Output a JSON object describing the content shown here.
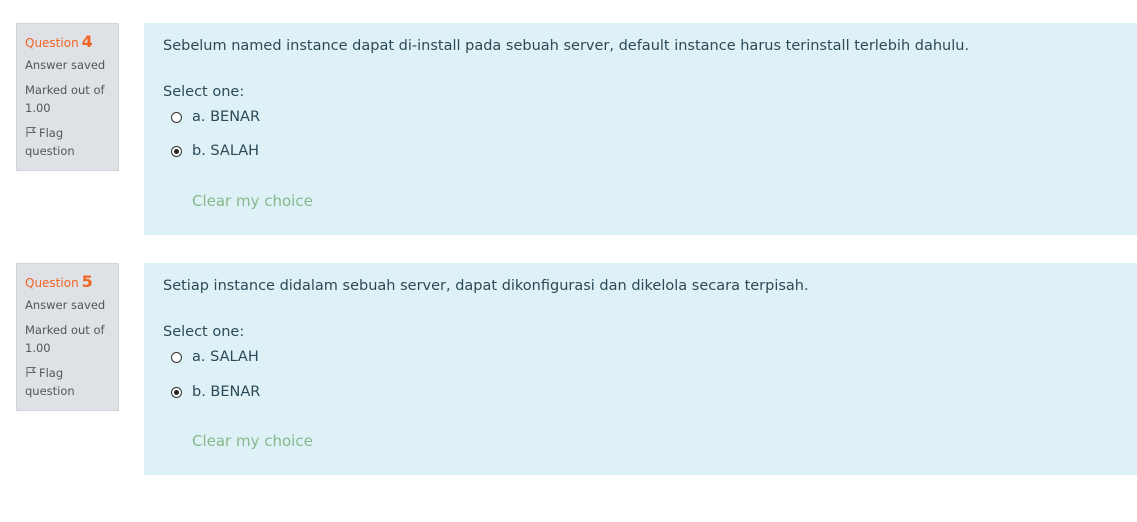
{
  "questions": [
    {
      "label": "Question",
      "number": "4",
      "state": "Answer saved",
      "grade": "Marked out of 1.00",
      "flag": "Flag question",
      "text": "Sebelum named instance dapat di-install pada sebuah server, default instance harus terinstall terlebih dahulu.",
      "prompt": "Select one:",
      "options": [
        {
          "label": "a. BENAR",
          "checked": false
        },
        {
          "label": "b. SALAH",
          "checked": true
        }
      ],
      "clear": "Clear my choice"
    },
    {
      "label": "Question",
      "number": "5",
      "state": "Answer saved",
      "grade": "Marked out of 1.00",
      "flag": "Flag question",
      "text": "Setiap instance didalam sebuah server, dapat dikonfigurasi dan dikelola secara terpisah.",
      "prompt": "Select one:",
      "options": [
        {
          "label": "a. SALAH",
          "checked": false
        },
        {
          "label": "b. BENAR",
          "checked": true
        }
      ],
      "clear": "Clear my choice"
    }
  ]
}
